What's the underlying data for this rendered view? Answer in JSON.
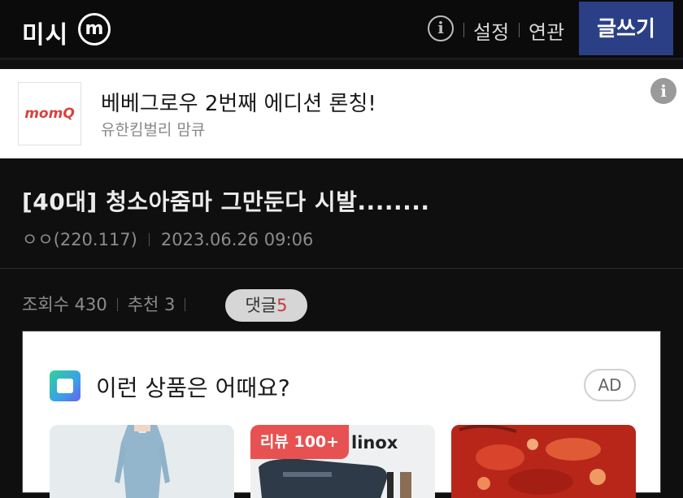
{
  "header": {
    "logo_text": "미시",
    "logo_mark": "m",
    "info_icon": "info-icon",
    "nav": [
      "설정",
      "연관"
    ],
    "write_button": "글쓰기"
  },
  "ad_banner": {
    "logo_text": "momQ",
    "title": "베베그로우 2번째 에디션 론칭!",
    "subtitle": "유한킴벌리 맘큐",
    "info_icon": "info-icon"
  },
  "post": {
    "title": "[40대] 청소아줌마 그만둔다 시발........",
    "author": "ㅇㅇ(220.117)",
    "datetime": "2023.06.26 09:06",
    "views_label": "조회수 430",
    "recommend_label": "추천 3",
    "comments_label": "댓글",
    "comments_count": "5"
  },
  "product_section": {
    "title": "이런 상품은 어때요?",
    "ad_label": "AD",
    "icon": "shopping-bag-icon",
    "items": [
      {
        "badge": "",
        "brand": "",
        "color": "#e6ebee"
      },
      {
        "badge": "리뷰 100+",
        "brand": "linox",
        "color": "#eef0f1"
      },
      {
        "badge": "",
        "brand": "",
        "color": "#c42a1c"
      }
    ]
  },
  "colors": {
    "background": "#0f0f0f",
    "write_button": "#2b3f86",
    "review_badge": "#e85151",
    "comment_count": "#c83a3a"
  }
}
